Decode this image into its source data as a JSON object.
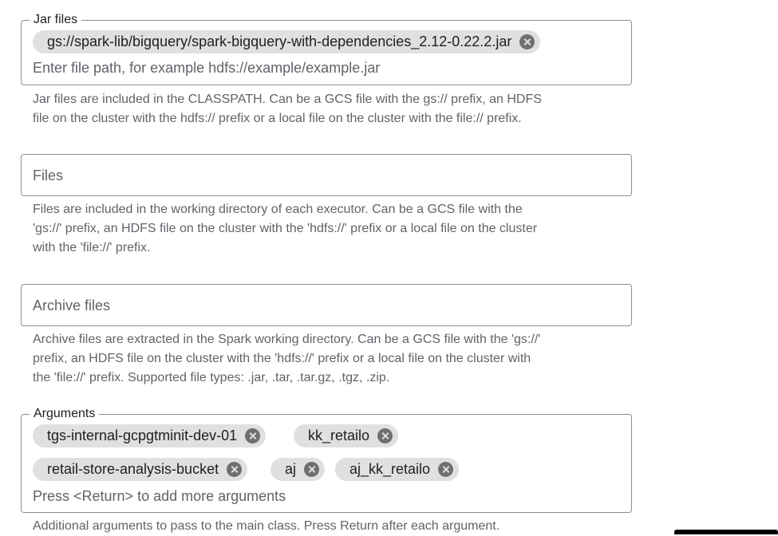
{
  "jar_files": {
    "legend": "Jar files",
    "chips": [
      "gs://spark-lib/bigquery/spark-bigquery-with-dependencies_2.12-0.22.2.jar"
    ],
    "placeholder": "Enter file path, for example hdfs://example/example.jar",
    "helper_line1": "Jar files are included in the CLASSPATH. Can be a GCS file with the gs:// prefix, an HDFS",
    "helper_line2": "file on the cluster with the hdfs:// prefix or a local file on the cluster with the file:// prefix."
  },
  "files": {
    "placeholder": "Files",
    "helper_line1": "Files are included in the working directory of each executor. Can be a GCS file with the",
    "helper_line2": "'gs://' prefix, an HDFS file on the cluster with the 'hdfs://' prefix or a local file on the cluster",
    "helper_line3": "with the 'file://' prefix."
  },
  "archive_files": {
    "placeholder": "Archive files",
    "helper_line1": "Archive files are extracted in the Spark working directory. Can be a GCS file with the 'gs://'",
    "helper_line2": "prefix, an HDFS file on the cluster with the 'hdfs://' prefix or a local file on the cluster with",
    "helper_line3": "the 'file://' prefix. Supported file types: .jar, .tar, .tar.gz, .tgz, .zip."
  },
  "arguments": {
    "legend": "Arguments",
    "chips": [
      "tgs-internal-gcpgtminit-dev-01",
      "kk_retailo",
      "retail-store-analysis-bucket",
      "aj",
      "aj_kk_retailo"
    ],
    "placeholder": "Press <Return> to add more arguments",
    "helper_line1": "Additional arguments to pass to the main class. Press Return after each argument."
  },
  "icons": {
    "chip_remove": "cancel-circle-icon"
  }
}
